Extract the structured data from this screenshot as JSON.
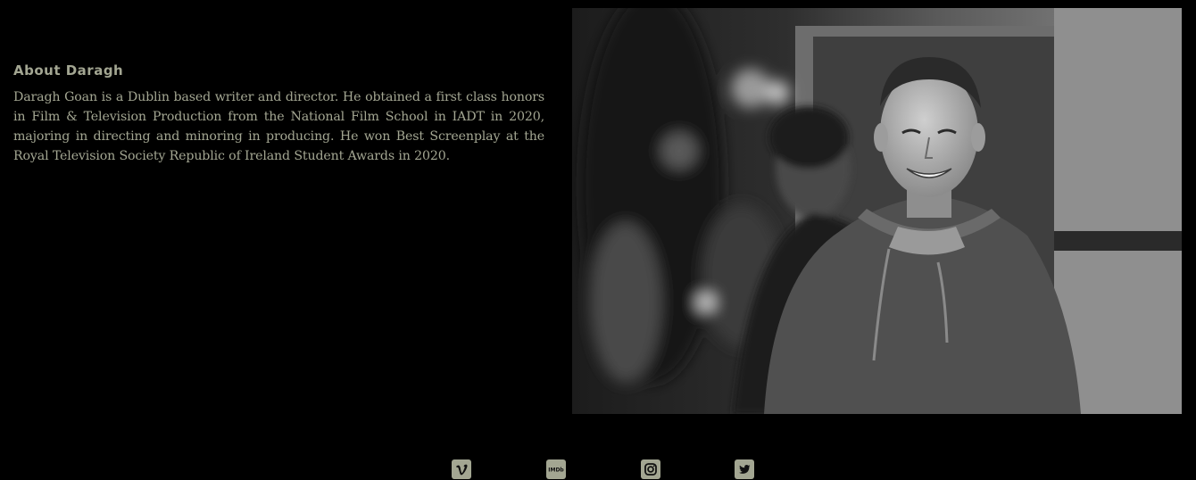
{
  "about": {
    "heading": "About Daragh",
    "bio": "Daragh Goan is a Dublin based writer and director. He obtained a first class honors in Film & Television Production from the National Film School in IADT in 2020, majoring in directing and minoring in producing. He won Best Screenplay at the Royal Television Society Republic of Ireland Student Awards in 2020."
  },
  "photo": {
    "subject": "portrait-photo"
  },
  "social": {
    "links": [
      {
        "name": "vimeo",
        "icon": "vimeo-icon"
      },
      {
        "name": "imdb",
        "icon": "imdb-icon",
        "label": "IMDb"
      },
      {
        "name": "instagram",
        "icon": "instagram-icon"
      },
      {
        "name": "twitter",
        "icon": "twitter-icon"
      }
    ]
  },
  "colors": {
    "background": "#000000",
    "text": "#a3a692",
    "icon_bg": "#a3a692",
    "icon_fg": "#111111"
  }
}
